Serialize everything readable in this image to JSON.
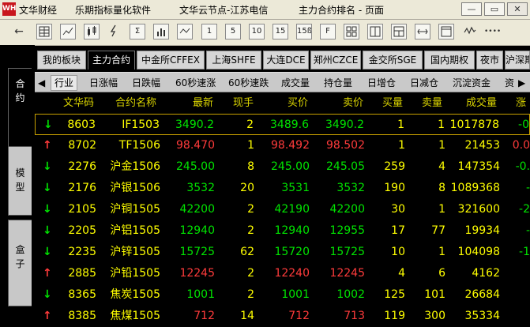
{
  "window": {
    "logo": "WH",
    "app_name": "文华财经",
    "software": "乐期指标量化软件",
    "server": "文华云节点-江苏电信",
    "page_title": "主力合约排名 - 页面",
    "min_glyph": "—",
    "restore_glyph": "▭",
    "close_glyph": "✕"
  },
  "toolbar": {
    "back_glyph": "←",
    "btn_1": "1",
    "btn_5": "5",
    "btn_10": "10",
    "btn_15": "15",
    "btn_15b": "15ß",
    "btn_F": "F",
    "more_glyph": "••••"
  },
  "left_tabs": [
    {
      "label": [
        "合",
        "约"
      ]
    },
    {
      "label": [
        "模",
        "型"
      ]
    },
    {
      "label": [
        "盒",
        "子"
      ]
    }
  ],
  "category_tabs": [
    "我的板块",
    "主力合约",
    "中金所CFFEX",
    "上海SHFE",
    "大连DCE",
    "郑州CZCE",
    "金交所SGE",
    "国内期权",
    "夜市",
    "沪深期"
  ],
  "sort_tabs": {
    "left_arrow": "◀",
    "items": [
      "行业",
      "日涨幅",
      "日跌幅",
      "60秒速涨",
      "60秒速跌",
      "成交量",
      "持仓量",
      "日增仓",
      "日减仓",
      "沉淀资金",
      "资"
    ],
    "right_arrow": "▶"
  },
  "table": {
    "headers": [
      "文华码",
      "合约名称",
      "最新",
      "现手",
      "买价",
      "卖价",
      "买量",
      "卖量",
      "成交量",
      "涨"
    ],
    "rows": [
      {
        "dir": "↓",
        "code": "8603",
        "name": "IF1503",
        "last": "3490.2",
        "hand": "2",
        "bid": "3489.6",
        "ask": "3490.2",
        "bidv": "1",
        "askv": "1",
        "vol": "1017878",
        "chg": "-0"
      },
      {
        "dir": "↑",
        "code": "8702",
        "name": "TF1506",
        "last": "98.470",
        "hand": "1",
        "bid": "98.492",
        "ask": "98.502",
        "bidv": "1",
        "askv": "1",
        "vol": "21453",
        "chg": "0.0"
      },
      {
        "dir": "↓",
        "code": "2276",
        "name": "沪金1506",
        "last": "245.00",
        "hand": "8",
        "bid": "245.00",
        "ask": "245.05",
        "bidv": "259",
        "askv": "4",
        "vol": "147354",
        "chg": "-0."
      },
      {
        "dir": "↓",
        "code": "2176",
        "name": "沪银1506",
        "last": "3532",
        "hand": "20",
        "bid": "3531",
        "ask": "3532",
        "bidv": "190",
        "askv": "8",
        "vol": "1089368",
        "chg": "-"
      },
      {
        "dir": "↓",
        "code": "2105",
        "name": "沪铜1505",
        "last": "42200",
        "hand": "2",
        "bid": "42190",
        "ask": "42200",
        "bidv": "30",
        "askv": "1",
        "vol": "321600",
        "chg": "-2"
      },
      {
        "dir": "↓",
        "code": "2205",
        "name": "沪铝1505",
        "last": "12940",
        "hand": "2",
        "bid": "12940",
        "ask": "12955",
        "bidv": "17",
        "askv": "77",
        "vol": "19934",
        "chg": "-"
      },
      {
        "dir": "↓",
        "code": "2235",
        "name": "沪锌1505",
        "last": "15725",
        "hand": "62",
        "bid": "15720",
        "ask": "15725",
        "bidv": "10",
        "askv": "1",
        "vol": "104098",
        "chg": "-1"
      },
      {
        "dir": "↑",
        "code": "2885",
        "name": "沪铅1505",
        "last": "12245",
        "hand": "2",
        "bid": "12240",
        "ask": "12245",
        "bidv": "4",
        "askv": "6",
        "vol": "4162",
        "chg": ""
      },
      {
        "dir": "↓",
        "code": "8365",
        "name": "焦炭1505",
        "last": "1001",
        "hand": "2",
        "bid": "1001",
        "ask": "1002",
        "bidv": "125",
        "askv": "101",
        "vol": "26684",
        "chg": ""
      },
      {
        "dir": "↑",
        "code": "8385",
        "name": "焦煤1505",
        "last": "712",
        "hand": "14",
        "bid": "712",
        "ask": "713",
        "bidv": "119",
        "askv": "300",
        "vol": "35334",
        "chg": ""
      }
    ]
  },
  "colors": {
    "up": "#ff3b3b",
    "down": "#00e400",
    "neutral": "#ffffff",
    "code": "#ffff00",
    "header": "#d8d200"
  }
}
